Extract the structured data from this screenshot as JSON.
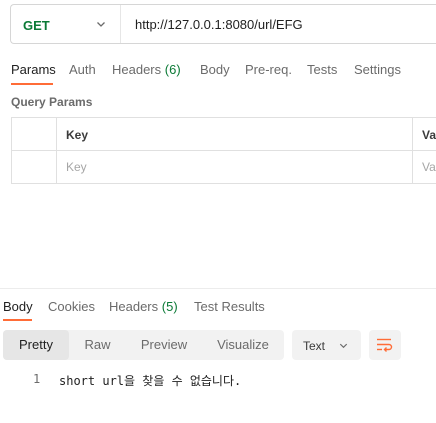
{
  "request": {
    "method": "GET",
    "url": "http://127.0.0.1:8080/url/EFG"
  },
  "request_tabs": [
    {
      "label": "Params",
      "active": true
    },
    {
      "label": "Auth"
    },
    {
      "label": "Headers",
      "count": "(6)"
    },
    {
      "label": "Body"
    },
    {
      "label": "Pre-req."
    },
    {
      "label": "Tests"
    },
    {
      "label": "Settings"
    }
  ],
  "query_params": {
    "title": "Query Params",
    "columns": [
      "Key",
      "Va"
    ],
    "placeholders": [
      "Key",
      "Va"
    ]
  },
  "response_tabs": [
    {
      "label": "Body",
      "active": true
    },
    {
      "label": "Cookies"
    },
    {
      "label": "Headers",
      "count": "(5)"
    },
    {
      "label": "Test Results"
    }
  ],
  "view_modes": [
    "Pretty",
    "Raw",
    "Preview",
    "Visualize"
  ],
  "active_view": "Pretty",
  "format": "Text",
  "response_body": {
    "line_number": "1",
    "text": "short url을 찾을 수 없습니다."
  },
  "colors": {
    "accent": "#ff6c37",
    "method_get": "#0b7a36",
    "wrap_icon": "#ff6c37"
  },
  "icons": {
    "method_dropdown": "chevron-down-icon",
    "format_dropdown": "chevron-down-icon",
    "wrap": "wrap-lines-icon"
  }
}
